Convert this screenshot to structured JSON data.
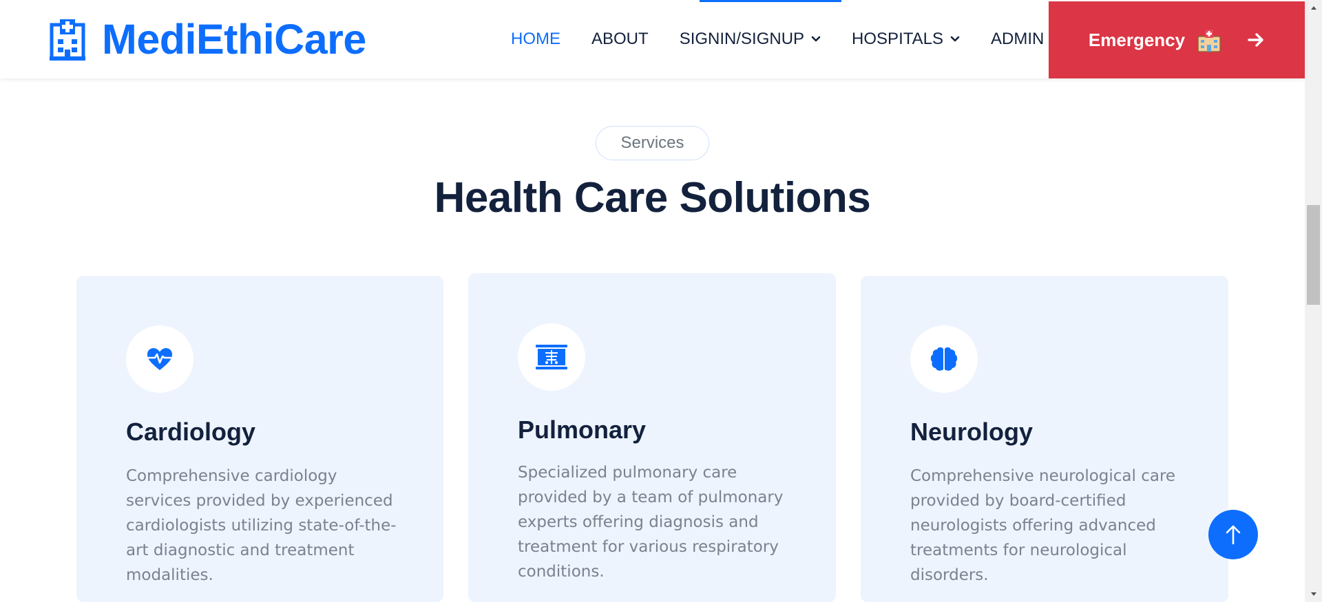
{
  "brand": {
    "name": "MediEthiCare",
    "icon": "hospital-icon",
    "color": "#0d6efd"
  },
  "nav": {
    "items": [
      {
        "label": "HOME",
        "active": true
      },
      {
        "label": "ABOUT",
        "active": false
      },
      {
        "label": "SIGNIN/SIGNUP",
        "dropdown": true
      },
      {
        "label": "HOSPITALS",
        "dropdown": true
      },
      {
        "label": "ADMIN",
        "active": false
      }
    ]
  },
  "emergency": {
    "label": "Emergency",
    "icon": "hospital-emoji-icon",
    "color": "#dc3545"
  },
  "section": {
    "badge": "Services",
    "title": "Health Care Solutions"
  },
  "services": [
    {
      "title": "Cardiology",
      "icon": "heart-pulse-icon",
      "description": "Comprehensive cardiology services provided by experienced cardiologists utilizing state-of-the-art diagnostic and treatment modalities."
    },
    {
      "title": "Pulmonary",
      "icon": "x-ray-icon",
      "description": "Specialized pulmonary care provided by a team of pulmonary experts offering diagnosis and treatment for various respiratory conditions."
    },
    {
      "title": "Neurology",
      "icon": "brain-icon",
      "description": "Comprehensive neurological care provided by board-certified neurologists offering advanced treatments for neurological disorders."
    }
  ],
  "scroll_top": {
    "icon": "arrow-up-icon"
  }
}
